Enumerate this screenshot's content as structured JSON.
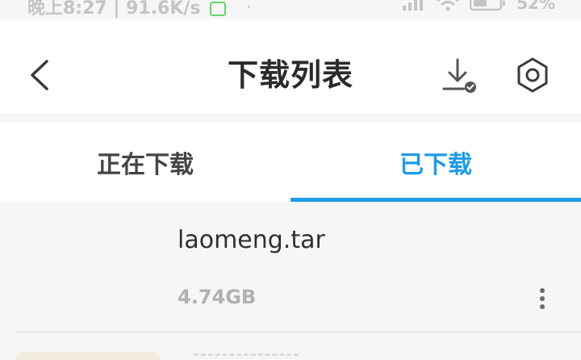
{
  "status_bar": {
    "time_speed": "晚上8:27 | 91.6K/s",
    "dot": "·",
    "battery": "52%",
    "icons": [
      "app-notification-icon",
      "signal-icon",
      "wifi-icon",
      "battery-icon"
    ]
  },
  "app_bar": {
    "title": "下载列表",
    "icons": [
      "back-arrow-icon",
      "download-done-icon",
      "hexagon-settings-icon"
    ]
  },
  "tabs": [
    {
      "label": "正在下载",
      "active": false
    },
    {
      "label": "已下载",
      "active": true
    }
  ],
  "files": [
    {
      "name": "laomeng.tar",
      "size": "4.74GB"
    }
  ],
  "colors": {
    "accent": "#1d9be6",
    "title": "#2b2b2b",
    "tab_inactive": "#444444",
    "file_size": "#b0b0b0",
    "background": "#f6f6f6"
  }
}
